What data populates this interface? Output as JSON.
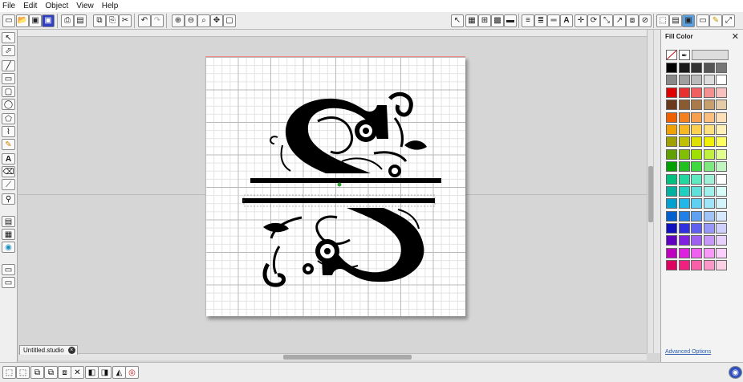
{
  "menu": [
    "File",
    "Edit",
    "Object",
    "View",
    "Help"
  ],
  "document_tab": {
    "label": "Untitled.studio"
  },
  "panel": {
    "title": "Fill Color",
    "advanced_link": "Advanced Options"
  },
  "palette": [
    "#000000",
    "#1a1a1a",
    "#333333",
    "#555555",
    "#777777",
    "#888888",
    "#a0a0a0",
    "#bbbbbb",
    "#dddddd",
    "#ffffff",
    "#e00000",
    "#e83030",
    "#f06060",
    "#f59090",
    "#f9c0c0",
    "#6a3a1a",
    "#8a5a30",
    "#aa7a4a",
    "#c8a070",
    "#e4cca8",
    "#f06000",
    "#f58020",
    "#f8a050",
    "#fbc080",
    "#fde0b8",
    "#f0a000",
    "#f8b820",
    "#fcd050",
    "#fde080",
    "#fff0b8",
    "#a0a000",
    "#c0c000",
    "#e0e000",
    "#f0f000",
    "#ffff60",
    "#60a000",
    "#80c000",
    "#a0e000",
    "#c0f040",
    "#e0ff90",
    "#00a000",
    "#20c020",
    "#40d840",
    "#80e880",
    "#c0f4c0",
    "#00c080",
    "#20d8a0",
    "#60e8c0",
    "#a0f0d8",
    "#ffffff",
    "#00b0a0",
    "#20d0c0",
    "#60e0d8",
    "#a0f0ec",
    "#d8fcfa",
    "#00a0d0",
    "#20b8e8",
    "#60d0f0",
    "#a0e4f8",
    "#d4f4fc",
    "#0060d0",
    "#2080e8",
    "#60a0f0",
    "#a0c4f8",
    "#d8e8fc",
    "#1010c0",
    "#3030e0",
    "#6060f0",
    "#9898f8",
    "#d0d0fc",
    "#6000c0",
    "#8020e0",
    "#a060f0",
    "#c898f8",
    "#e8d0fc",
    "#c000c0",
    "#e020e0",
    "#f060f0",
    "#f898f8",
    "#fcd0fc",
    "#e00060",
    "#f02080",
    "#f860a8",
    "#fa98c8",
    "#fcd0e4"
  ],
  "icons": {
    "toolbar": [
      "new-doc-icon",
      "open-icon",
      "save-icon",
      "save-as-icon",
      "print-icon",
      "cutter-icon",
      "copy-icon",
      "paste-icon",
      "cut-icon",
      "undo-icon",
      "redo-icon",
      "zoom-in-icon",
      "zoom-out-icon",
      "zoom-box-icon",
      "pan-icon",
      "fit-page-icon",
      "pointer-icon",
      "page-setup-icon",
      "grid-icon",
      "fill-icon",
      "line-icon",
      "text-style-icon",
      "align-icon",
      "replicate-icon",
      "transform-icon",
      "offset-icon",
      "trace-icon",
      "library-icon",
      "store-icon",
      "send-icon"
    ],
    "left_tools": [
      "select-icon",
      "edit-points-icon",
      "line-tool-icon",
      "rect-tool-icon",
      "rounded-rect-icon",
      "ellipse-tool-icon",
      "polygon-tool-icon",
      "curve-tool-icon",
      "freehand-icon",
      "text-tool-icon",
      "eraser-icon",
      "knife-icon",
      "eyedropper-icon",
      "layers-icon",
      "library-panel-icon",
      "store-panel-icon"
    ]
  }
}
